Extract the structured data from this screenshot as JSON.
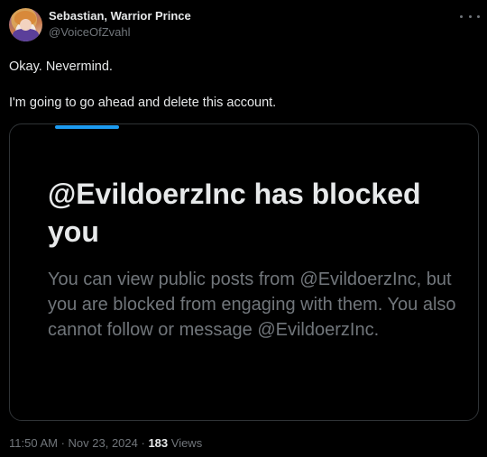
{
  "author": {
    "display_name": "Sebastian, Warrior Prince",
    "handle": "@VoiceOfZvahl",
    "avatar_icon": "profile-avatar"
  },
  "post": {
    "line1": "Okay. Nevermind.",
    "line2": "I'm going to go ahead and delete this account."
  },
  "media": {
    "title": "@EvildoerzInc has blocked you",
    "body": "You can view public posts from @EvildoerzInc, but you are blocked from engaging with them. You also cannot follow or message @EvildoerzInc."
  },
  "meta": {
    "time": "11:50 AM",
    "separator1": " · ",
    "date": "Nov 23, 2024",
    "separator2": " · ",
    "views_count": "183",
    "views_label": " Views"
  },
  "colors": {
    "background": "#000000",
    "text_primary": "#e7e9ea",
    "text_secondary": "#71767b",
    "border": "#2f3336",
    "accent": "#1d9bf0"
  },
  "icons": {
    "more": "more-horizontal-icon"
  }
}
